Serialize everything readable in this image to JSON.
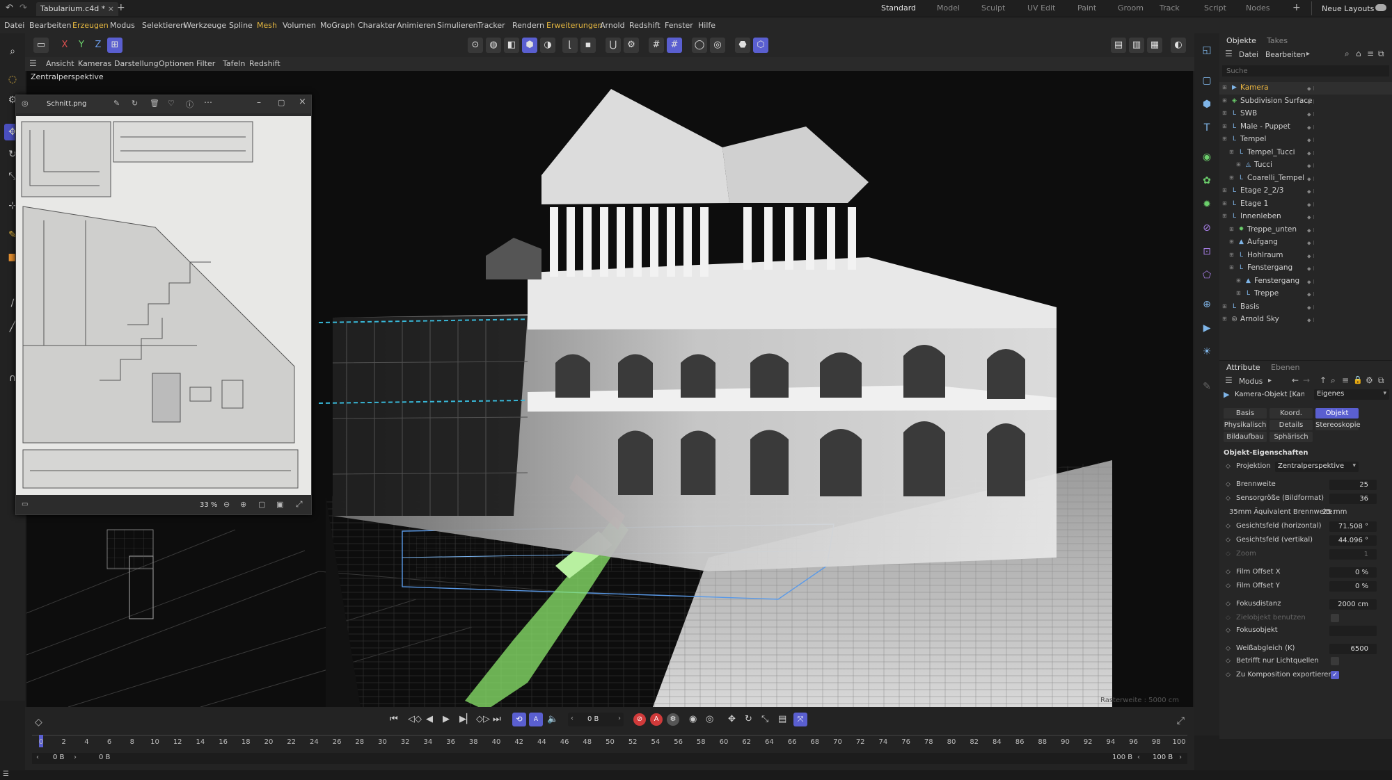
{
  "app": {
    "document_tab": "Tabularium.c4d *",
    "layouts": [
      "Standard",
      "Model",
      "Sculpt",
      "UV Edit",
      "Paint",
      "Groom",
      "Track",
      "Script",
      "Nodes"
    ],
    "active_layout": "Standard",
    "new_layouts": "Neue Layouts"
  },
  "menu": [
    "Datei",
    "Bearbeiten",
    "Erzeugen",
    "Modus",
    "Selektieren",
    "Werkzeuge",
    "Spline",
    "Mesh",
    "Volumen",
    "MoGraph",
    "Charakter",
    "Animieren",
    "Simulieren",
    "Tracker",
    "Rendern",
    "Erweiterungen",
    "Arnold",
    "Redshift",
    "Fenster",
    "Hilfe"
  ],
  "toolbar": {
    "axis_x": "X",
    "axis_y": "Y",
    "axis_z": "Z"
  },
  "viewport": {
    "menu": [
      "Ansicht",
      "Kameras",
      "Darstellung",
      "Optionen",
      "Filter",
      "Tafeln",
      "Redshift"
    ],
    "label": "Zentralperspektive",
    "grid_label": "Rasterweite : 5000 cm"
  },
  "viewer": {
    "filename": "Schnitt.png",
    "zoom": "33 %"
  },
  "objects_panel": {
    "tabs": [
      "Objekte",
      "Takes"
    ],
    "menu": [
      "Datei",
      "Bearbeiten"
    ],
    "search_placeholder": "Suche",
    "items": [
      {
        "name": "Kamera",
        "icon": "camera-icon",
        "depth": 0,
        "selected": true
      },
      {
        "name": "Subdivision Surface",
        "icon": "subdivision-icon",
        "depth": 0
      },
      {
        "name": "SWB",
        "icon": "null-icon",
        "depth": 0
      },
      {
        "name": "Male - Puppet",
        "icon": "null-icon",
        "depth": 0
      },
      {
        "name": "Tempel",
        "icon": "null-icon",
        "depth": 0
      },
      {
        "name": "Tempel_Tucci",
        "icon": "null-icon",
        "depth": 1
      },
      {
        "name": "Tucci",
        "icon": "polygon-icon",
        "depth": 2
      },
      {
        "name": "Coarelli_Tempel",
        "icon": "null-icon",
        "depth": 1
      },
      {
        "name": "Etage 2_2/3",
        "icon": "null-icon",
        "depth": 0
      },
      {
        "name": "Etage 1",
        "icon": "null-icon",
        "depth": 0
      },
      {
        "name": "Innenleben",
        "icon": "null-icon",
        "depth": 0
      },
      {
        "name": "Treppe_unten",
        "icon": "generator-icon",
        "depth": 1
      },
      {
        "name": "Aufgang",
        "icon": "mesh-icon",
        "depth": 1
      },
      {
        "name": "Hohlraum",
        "icon": "null-icon",
        "depth": 1
      },
      {
        "name": "Fenstergang",
        "icon": "null-icon",
        "depth": 1
      },
      {
        "name": "Fenstergang",
        "icon": "mesh-icon",
        "depth": 2
      },
      {
        "name": "Treppe",
        "icon": "null-icon",
        "depth": 2
      },
      {
        "name": "Basis",
        "icon": "null-icon",
        "depth": 0
      },
      {
        "name": "Arnold Sky",
        "icon": "sky-icon",
        "depth": 0
      }
    ]
  },
  "attributes_panel": {
    "tabs": [
      "Attribute",
      "Ebenen"
    ],
    "mode": "Modus",
    "object_title": "Kamera-Objekt [Kamera]",
    "preset": "Eigenes",
    "subtabs": [
      "Basis",
      "Koord.",
      "Objekt",
      "Physikalisch",
      "Details",
      "Stereoskopie",
      "Bildaufbau",
      "Sphärisch"
    ],
    "active_subtab": "Objekt",
    "section": "Objekt-Eigenschaften",
    "projection_label": "Projektion",
    "projection_value": "Zentralperspektive",
    "props": [
      {
        "label": "Brennweite",
        "value": "25"
      },
      {
        "label": "Sensorgröße (Bildformat)",
        "value": "36"
      },
      {
        "label": "35mm Äquivalent Brennweite:",
        "value": "25 mm",
        "plain": true
      },
      {
        "label": "Gesichtsfeld (horizontal)",
        "value": "71.508 °"
      },
      {
        "label": "Gesichtsfeld (vertikal)",
        "value": "44.096 °"
      },
      {
        "label": "Zoom",
        "value": "1",
        "dim": true
      },
      {
        "label": "Film Offset X",
        "value": "0 %"
      },
      {
        "label": "Film Offset Y",
        "value": "0 %"
      },
      {
        "label": "Fokusdistanz",
        "value": "2000 cm"
      },
      {
        "label": "Zielobjekt benutzen",
        "check": false,
        "dim": true
      },
      {
        "label": "Fokusobjekt",
        "value": ""
      },
      {
        "label": "Weißabgleich (K)",
        "value": "6500"
      },
      {
        "label": "Betrifft nur Lichtquellen",
        "check": false
      },
      {
        "label": "Zu Komposition exportieren",
        "check": true
      }
    ]
  },
  "timeline": {
    "frame": "0 B",
    "start": "0 B",
    "start2": "0 B",
    "end": "100 B",
    "end2": "100 B",
    "ticks": [
      "0",
      "2",
      "4",
      "6",
      "8",
      "10",
      "12",
      "14",
      "16",
      "18",
      "20",
      "22",
      "24",
      "26",
      "28",
      "30",
      "32",
      "34",
      "36",
      "38",
      "40",
      "42",
      "44",
      "46",
      "48",
      "50",
      "52",
      "54",
      "56",
      "58",
      "60",
      "62",
      "64",
      "66",
      "68",
      "70",
      "72",
      "74",
      "76",
      "78",
      "80",
      "82",
      "84",
      "86",
      "88",
      "90",
      "92",
      "94",
      "96",
      "98",
      "100"
    ]
  },
  "colors": {
    "accent": "#5a5fd0",
    "selected": "#f0b940",
    "record": "#d03a3a"
  }
}
